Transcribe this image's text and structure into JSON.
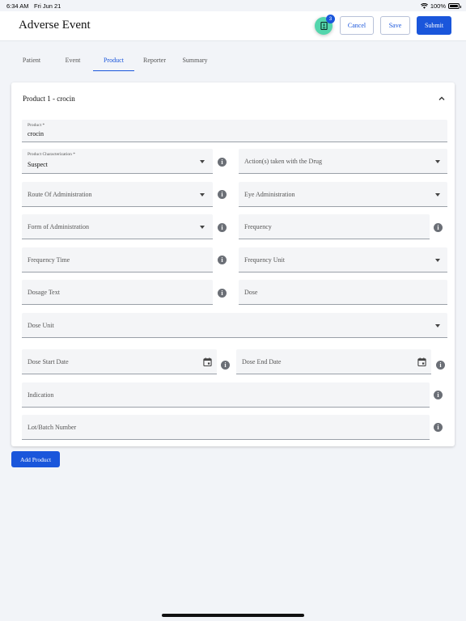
{
  "status": {
    "time": "6:34 AM",
    "date": "Fri Jun 21",
    "battery": "100%"
  },
  "header": {
    "title": "Adverse Event",
    "badge_count": "3",
    "cancel_label": "Cancel",
    "save_label": "Save",
    "submit_label": "Submit"
  },
  "tabs": [
    {
      "label": "Patient"
    },
    {
      "label": "Event"
    },
    {
      "label": "Product",
      "active": true
    },
    {
      "label": "Reporter"
    },
    {
      "label": "Summary"
    }
  ],
  "product_card": {
    "title": "Product 1 - crocin",
    "fields": {
      "product": {
        "label": "Product *",
        "value": "crocin"
      },
      "characterization": {
        "label": "Product Characterization *",
        "value": "Suspect"
      },
      "actions": {
        "placeholder": "Action(s) taken with the Drug"
      },
      "route": {
        "placeholder": "Route Of Administration"
      },
      "eye": {
        "placeholder": "Eye Administration"
      },
      "form": {
        "placeholder": "Form of Administration"
      },
      "frequency": {
        "placeholder": "Frequency"
      },
      "frequency_time": {
        "placeholder": "Frequency Time"
      },
      "frequency_unit": {
        "placeholder": "Frequency Unit"
      },
      "dosage_text": {
        "placeholder": "Dosage Text"
      },
      "dose": {
        "placeholder": "Dose"
      },
      "dose_unit": {
        "placeholder": "Dose Unit"
      },
      "dose_start": {
        "placeholder": "Dose Start Date"
      },
      "dose_end": {
        "placeholder": "Dose End Date"
      },
      "indication": {
        "placeholder": "Indication"
      },
      "lot": {
        "placeholder": "Lot/Batch Number"
      }
    }
  },
  "add_product_label": "Add Product",
  "colors": {
    "accent": "#1a56db",
    "fab": "#54d6ad",
    "field_bg": "#f4f5f7",
    "info_icon": "#6b6f76"
  }
}
